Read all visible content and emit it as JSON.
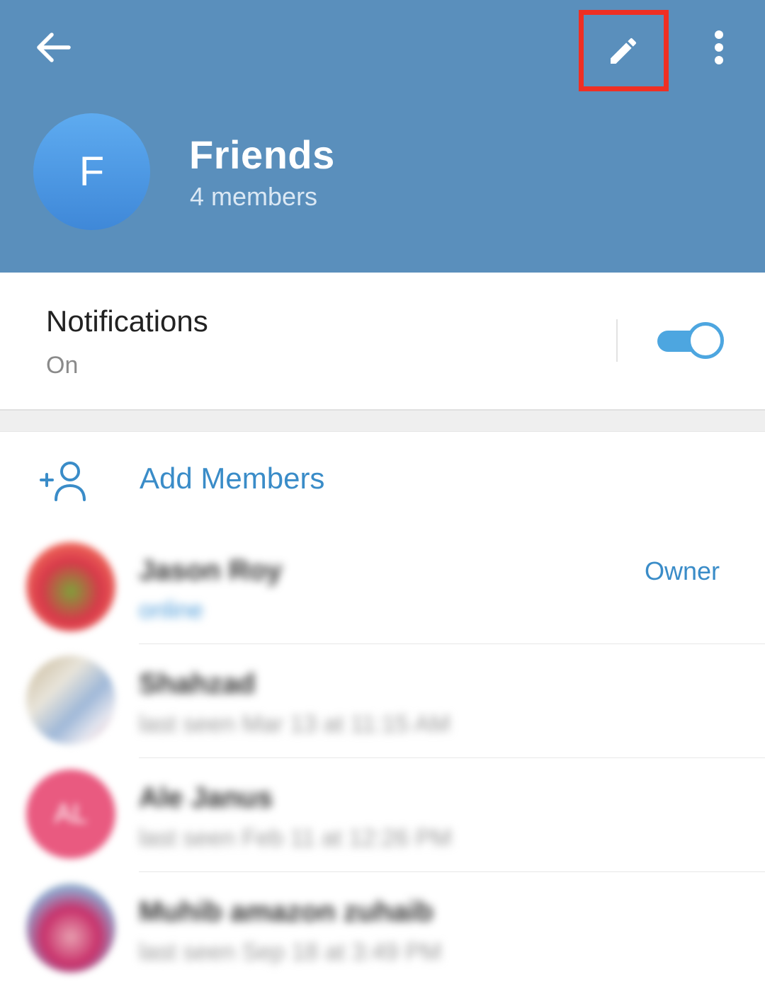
{
  "header": {
    "group_initial": "F",
    "title": "Friends",
    "subtitle": "4 members",
    "background_color": "#5a8fbc",
    "icons": {
      "back": "arrow-left-icon",
      "edit": "pencil-icon",
      "more": "more-vertical-icon"
    },
    "highlight_color": "#ef2f23"
  },
  "notifications": {
    "title": "Notifications",
    "status": "On",
    "toggle_on": true
  },
  "add_members": {
    "label": "Add Members",
    "icon": "add-user-icon"
  },
  "members": [
    {
      "name": "Jason Roy",
      "status": "online",
      "role": "Owner"
    },
    {
      "name": "Shahzad",
      "status": "last seen Mar 13 at 11:15 AM",
      "role": ""
    },
    {
      "name": "Ale Janus",
      "status": "last seen Feb 11 at 12:26 PM",
      "avatar_initials": "AL",
      "role": ""
    },
    {
      "name": "Muhib amazon zuhaib",
      "status": "last seen Sep 18 at 3:49 PM",
      "role": ""
    }
  ],
  "accent_color": "#3a8cc8"
}
